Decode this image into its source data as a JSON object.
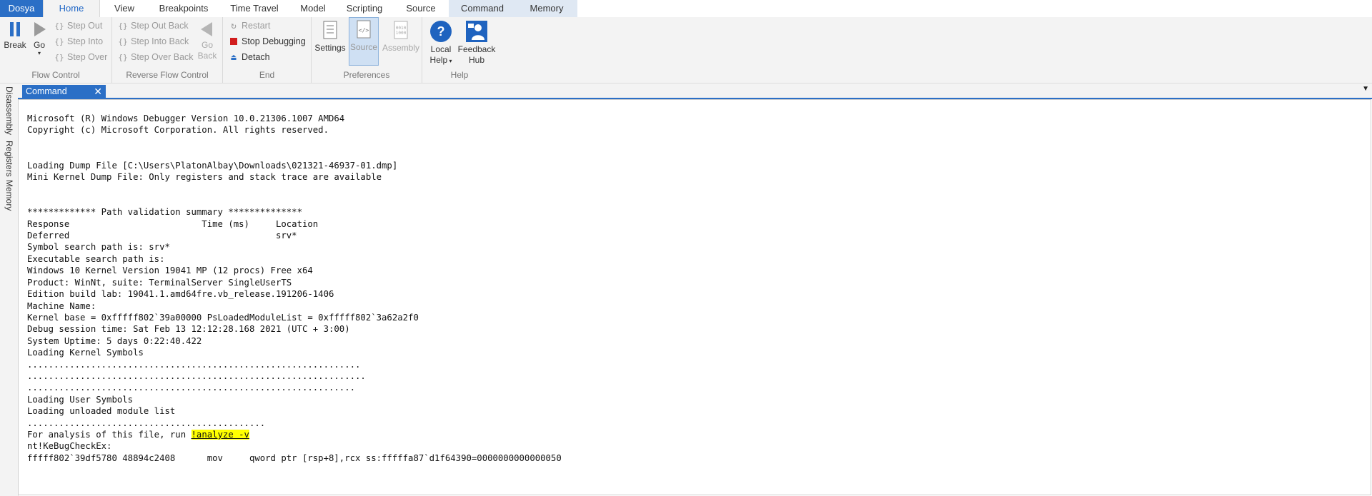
{
  "tabs": {
    "file": "Dosya",
    "home": "Home",
    "view": "View",
    "breakpoints": "Breakpoints",
    "time_travel": "Time Travel",
    "model": "Model",
    "scripting": "Scripting",
    "source": "Source",
    "command": "Command",
    "memory": "Memory"
  },
  "ribbon": {
    "flow_control": {
      "break": "Break",
      "go": "Go",
      "step_out": "Step Out",
      "step_into": "Step Into",
      "step_over": "Step Over",
      "label": "Flow Control"
    },
    "reverse_flow": {
      "step_out_back": "Step Out Back",
      "step_into_back": "Step Into Back",
      "step_over_back": "Step Over Back",
      "go_back_line1": "Go",
      "go_back_line2": "Back",
      "label": "Reverse Flow Control"
    },
    "end": {
      "restart": "Restart",
      "stop": "Stop Debugging",
      "detach": "Detach",
      "label": "End"
    },
    "preferences": {
      "settings": "Settings",
      "source": "Source",
      "assembly": "Assembly",
      "label": "Preferences"
    },
    "help": {
      "local_help_line1": "Local",
      "local_help_line2": "Help",
      "feedback_line1": "Feedback",
      "feedback_line2": "Hub",
      "label": "Help"
    }
  },
  "side_tabs": {
    "disassembly": "Disassembly",
    "registers": "Registers",
    "memory": "Memory"
  },
  "doc_tab": {
    "title": "Command",
    "close": "✕"
  },
  "console": {
    "lines_before": "Microsoft (R) Windows Debugger Version 10.0.21306.1007 AMD64\nCopyright (c) Microsoft Corporation. All rights reserved.\n\n\nLoading Dump File [C:\\Users\\PlatonAlbay\\Downloads\\021321-46937-01.dmp]\nMini Kernel Dump File: Only registers and stack trace are available\n\n\n************* Path validation summary **************\nResponse                         Time (ms)     Location\nDeferred                                       srv*\nSymbol search path is: srv*\nExecutable search path is:\nWindows 10 Kernel Version 19041 MP (12 procs) Free x64\nProduct: WinNt, suite: TerminalServer SingleUserTS\nEdition build lab: 19041.1.amd64fre.vb_release.191206-1406\nMachine Name:\nKernel base = 0xfffff802`39a00000 PsLoadedModuleList = 0xfffff802`3a62a2f0\nDebug session time: Sat Feb 13 12:12:28.168 2021 (UTC + 3:00)\nSystem Uptime: 5 days 0:22:40.422\nLoading Kernel Symbols\n...............................................................\n................................................................\n..............................................................\nLoading User Symbols\nLoading unloaded module list\n.............................................\n",
    "analysis_prefix": "For analysis of this file, run ",
    "analyze_link": "!analyze -v",
    "lines_after": "\nnt!KeBugCheckEx:\nfffff802`39df5780 48894c2408      mov     qword ptr [rsp+8],rcx ss:fffffa87`d1f64390=0000000000000050"
  }
}
